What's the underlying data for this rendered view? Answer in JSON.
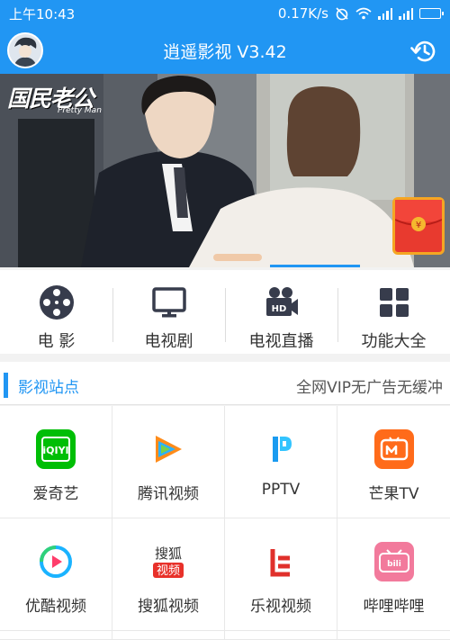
{
  "status": {
    "time": "上午10:43",
    "speed": "0.17K/s"
  },
  "header": {
    "title": "逍遥影视 V3.42"
  },
  "banner": {
    "show_title": "国民老公",
    "show_subtitle": "Pretty Man"
  },
  "menu": [
    {
      "label": "电 影",
      "icon": "film-reel-icon"
    },
    {
      "label": "电视剧",
      "icon": "tv-icon"
    },
    {
      "label": "电视直播",
      "icon": "hd-camera-icon"
    },
    {
      "label": "功能大全",
      "icon": "grid-icon"
    }
  ],
  "section": {
    "title": "影视站点",
    "subtitle": "全网VIP无广告无缓冲"
  },
  "sites": [
    {
      "label": "爱奇艺",
      "icon": "iqiyi-icon",
      "color": "#00be06"
    },
    {
      "label": "腾讯视频",
      "icon": "tencent-video-icon",
      "color": "#ff7e1a"
    },
    {
      "label": "PPTV",
      "icon": "pptv-icon",
      "color": "#1a9bf0"
    },
    {
      "label": "芒果TV",
      "icon": "mango-tv-icon",
      "color": "#ff6b1a"
    },
    {
      "label": "优酷视频",
      "icon": "youku-icon",
      "color": "#1ab3ff"
    },
    {
      "label": "搜狐视频",
      "icon": "sohu-video-icon",
      "color": "#e8312a"
    },
    {
      "label": "乐视视频",
      "icon": "letv-icon",
      "color": "#e0302b"
    },
    {
      "label": "哔哩哔哩",
      "icon": "bilibili-icon",
      "color": "#f27a9c"
    }
  ],
  "colors": {
    "primary": "#2196f3"
  }
}
